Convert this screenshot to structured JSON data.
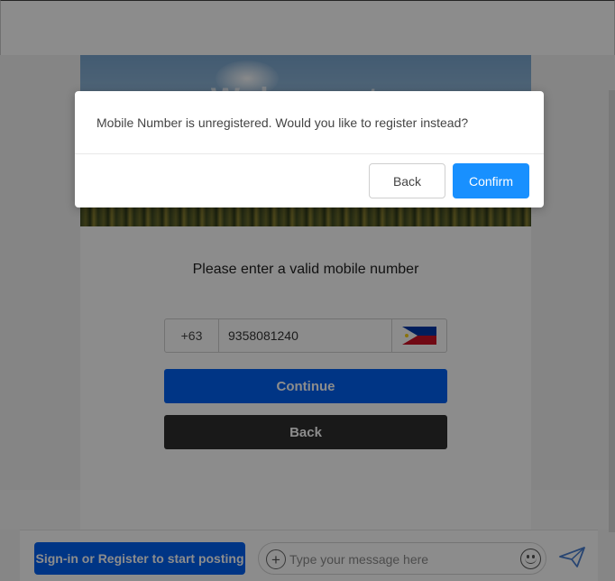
{
  "hero": {
    "title": "Welcome to Loudly"
  },
  "form": {
    "instruction": "Please enter a valid mobile number",
    "country_code": "+63",
    "phone_value": "9358081240",
    "flag_icon": "philippines-flag-icon",
    "continue_label": "Continue",
    "back_label": "Back"
  },
  "compose": {
    "signin_label": "Sign-in or Register to start posting",
    "message_placeholder": "Type your message here",
    "add_icon": "plus-circle-icon",
    "emoji_icon": "smiley-icon",
    "send_icon": "paper-plane-icon"
  },
  "modal": {
    "message": "Mobile Number is unregistered. Would you like to register instead?",
    "back_label": "Back",
    "confirm_label": "Confirm"
  },
  "colors": {
    "primary": "#0061f2",
    "confirm": "#1890ff",
    "dark_button": "#2f2f2f"
  }
}
